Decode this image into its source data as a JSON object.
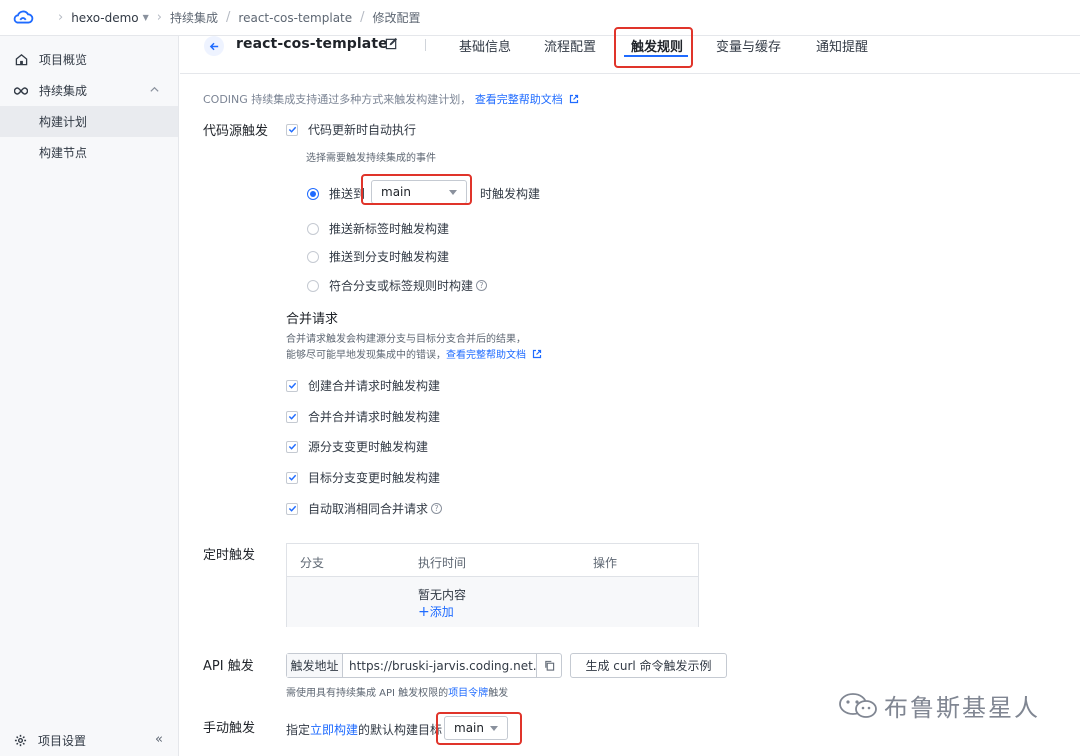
{
  "topbar": {
    "breadcrumbs": {
      "project": "hexo-demo",
      "ci": "持续集成",
      "repo": "react-cos-template",
      "page": "修改配置"
    }
  },
  "sidebar": {
    "items": [
      {
        "label": "项目概览"
      },
      {
        "label": "持续集成"
      },
      {
        "label": "构建计划"
      },
      {
        "label": "构建节点"
      }
    ],
    "settings": "项目设置",
    "collapse": "«"
  },
  "header": {
    "title": "react-cos-template",
    "tabs": [
      {
        "label": "基础信息"
      },
      {
        "label": "流程配置"
      },
      {
        "label": "触发规则"
      },
      {
        "label": "变量与缓存"
      },
      {
        "label": "通知提醒"
      }
    ]
  },
  "intro": {
    "text": "CODING 持续集成支持通过多种方式来触发构建计划，",
    "link": "查看完整帮助文档"
  },
  "code_trigger": {
    "label": "代码源触发",
    "auto_run": "代码更新时自动执行",
    "select_hint": "选择需要触发持续集成的事件",
    "push_to": "推送到",
    "branch": "main",
    "push_suffix": "时触发构建",
    "opt_tag": "推送新标签时触发构建",
    "opt_branch": "推送到分支时触发构建",
    "opt_rule": "符合分支或标签规则时构建"
  },
  "merge": {
    "title": "合并请求",
    "desc1": "合并请求触发会构建源分支与目标分支合并后的结果，",
    "desc2": "能够尽可能早地发现集成中的错误，",
    "link": "查看完整帮助文档",
    "items": [
      {
        "label": "创建合并请求时触发构建"
      },
      {
        "label": "合并合并请求时触发构建"
      },
      {
        "label": "源分支变更时触发构建"
      },
      {
        "label": "目标分支变更时触发构建"
      },
      {
        "label": "自动取消相同合并请求"
      }
    ]
  },
  "schedule": {
    "label": "定时触发",
    "columns": [
      "分支",
      "执行时间",
      "操作"
    ],
    "empty": "暂无内容",
    "add": "添加"
  },
  "api": {
    "label": "API 触发",
    "addon": "触发地址",
    "url": "https://bruski-jarvis.coding.net...",
    "curl_button": "生成 curl 命令触发示例",
    "note_prefix": "需使用具有持续集成 API 触发权限的",
    "note_link": "项目令牌",
    "note_suffix": "触发"
  },
  "manual": {
    "label": "手动触发",
    "prefix": "指定",
    "link": "立即构建",
    "suffix": "的默认构建目标",
    "branch": "main"
  },
  "watermark": "布鲁斯基星人",
  "colors": {
    "accent": "#1f6bff",
    "highlight": "#e0342a"
  }
}
